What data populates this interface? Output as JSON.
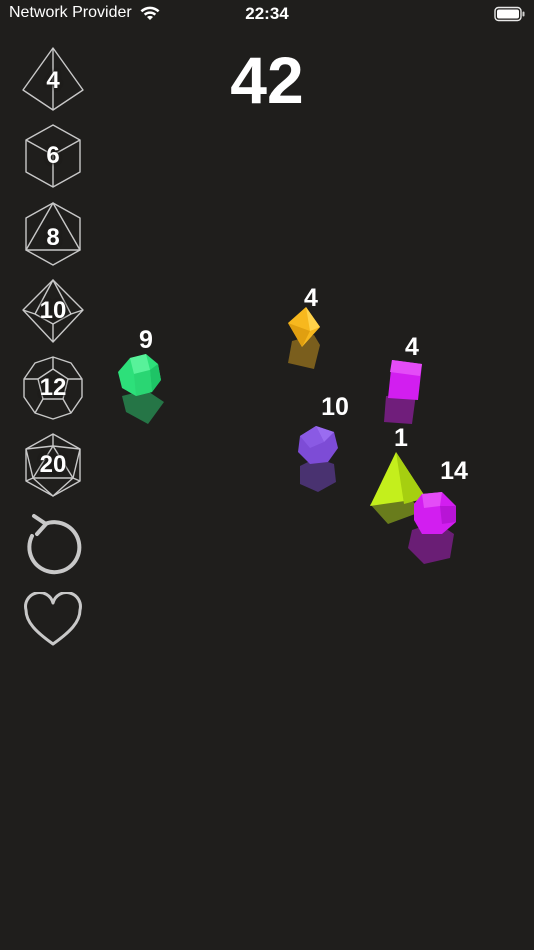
{
  "status_bar": {
    "carrier": "Network Provider",
    "time": "22:34",
    "wifi_icon": "wifi-icon",
    "battery_icon": "battery-icon"
  },
  "total": "42",
  "sidebar": {
    "dice": [
      {
        "sides": "4",
        "icon": "d4-tetrahedron-icon"
      },
      {
        "sides": "6",
        "icon": "d6-cube-icon"
      },
      {
        "sides": "8",
        "icon": "d8-octahedron-icon"
      },
      {
        "sides": "10",
        "icon": "d10-icon"
      },
      {
        "sides": "12",
        "icon": "d12-dodecahedron-icon"
      },
      {
        "sides": "20",
        "icon": "d20-icosahedron-icon"
      }
    ],
    "reset_icon": "reset-icon",
    "favorite_icon": "heart-icon"
  },
  "table": {
    "dice": [
      {
        "type": "d12",
        "value": "9",
        "color": "#2de07a"
      },
      {
        "type": "d8",
        "value": "4",
        "color": "#f7b81e"
      },
      {
        "type": "d6",
        "value": "4",
        "color": "#d21ef0"
      },
      {
        "type": "d10",
        "value": "10",
        "color": "#7d4cd6"
      },
      {
        "type": "d4",
        "value": "1",
        "color": "#c4ef1c"
      },
      {
        "type": "d20",
        "value": "14",
        "color": "#d21ef0"
      }
    ]
  },
  "colors": {
    "background": "#1f1e1c",
    "outline": "#c8c8c8",
    "text": "#ffffff"
  }
}
